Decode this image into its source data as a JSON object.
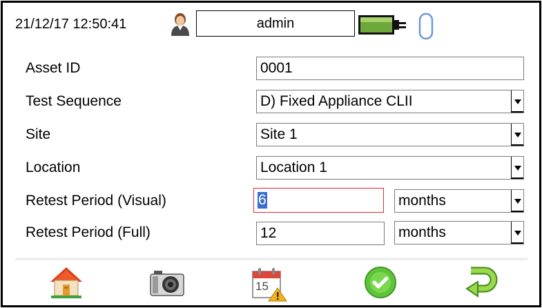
{
  "header": {
    "datetime": "21/12/17 12:50:41",
    "user": "admin",
    "icons": {
      "user": "user-icon",
      "battery": "battery-icon",
      "usb": "usb-icon"
    }
  },
  "form": {
    "asset_id": {
      "label": "Asset ID",
      "value": "0001"
    },
    "test_sequence": {
      "label": "Test Sequence",
      "value": "D) Fixed Appliance CLII"
    },
    "site": {
      "label": "Site",
      "value": "Site 1"
    },
    "location": {
      "label": "Location",
      "value": "Location 1"
    },
    "retest_visual": {
      "label": "Retest Period (Visual)",
      "value": "6",
      "unit": "months"
    },
    "retest_full": {
      "label": "Retest Period (Full)",
      "value": "12",
      "unit": "months"
    }
  },
  "toolbar": {
    "items": [
      {
        "name": "home-icon"
      },
      {
        "name": "camera-icon"
      },
      {
        "name": "calendar-warning-icon",
        "text": "15"
      },
      {
        "name": "confirm-icon"
      },
      {
        "name": "back-icon"
      }
    ]
  },
  "colors": {
    "active_border": "#e02a2a",
    "selection": "#3a6fd0",
    "battery": "#6fa83a",
    "confirm": "#5fc43a",
    "usb": "#6f97d6"
  }
}
